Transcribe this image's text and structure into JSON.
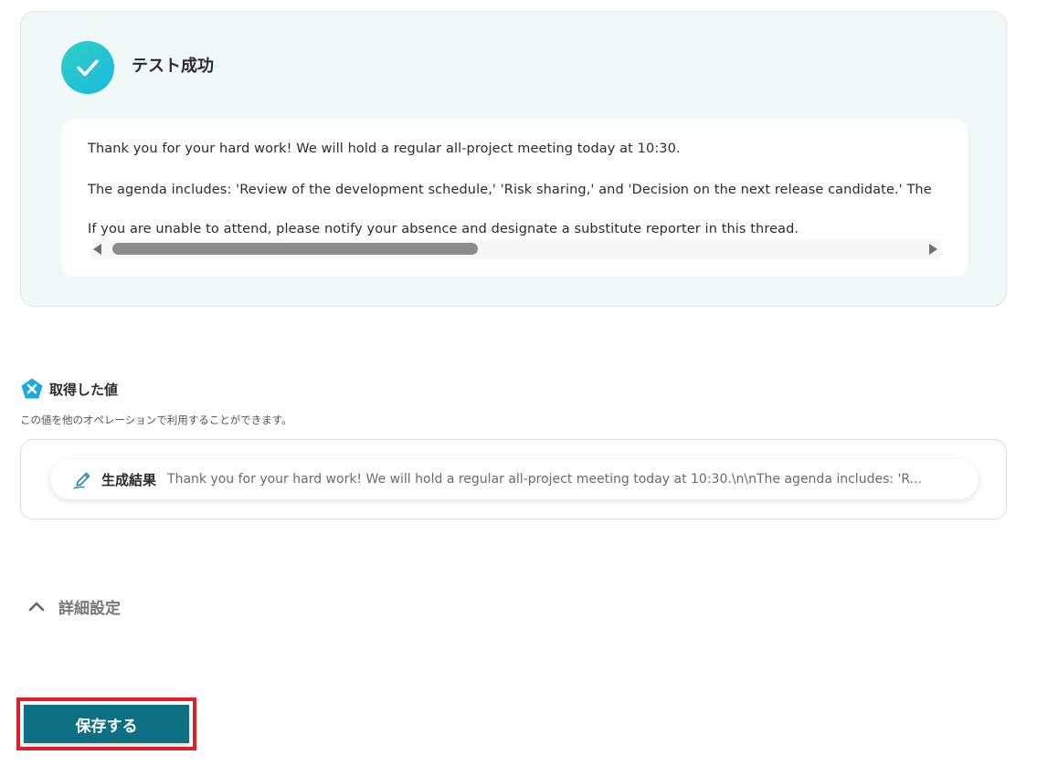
{
  "test_result": {
    "status_title": "テスト成功",
    "output_lines": [
      "Thank you for your hard work! We will hold a regular all-project meeting today at 10:30.",
      "The agenda includes: 'Review of the development schedule,' 'Risk sharing,' and 'Decision on the next release candidate.' The",
      "If you are unable to attend, please notify your absence and designate a substitute reporter in this thread."
    ],
    "icon": "check-icon"
  },
  "acquired_values": {
    "title": "取得した値",
    "description": "この値を他のオペレーションで利用することができます。",
    "icon": "yoom-logo-icon",
    "items": [
      {
        "label": "生成結果",
        "value": "Thank you for your hard work! We will hold a regular all-project meeting today at 10:30.\\n\\nThe agenda includes: 'R...",
        "icon": "pen-icon"
      }
    ]
  },
  "details": {
    "label": "詳細設定",
    "icon": "chevron-up-icon"
  },
  "save_button": {
    "label": "保存する"
  },
  "colors": {
    "accent": "#0e6f82",
    "success_gradient_start": "#2ed0c6",
    "success_gradient_end": "#1cb8de",
    "highlight_border": "#e01f26",
    "logo_blue": "#1aa9e0"
  }
}
